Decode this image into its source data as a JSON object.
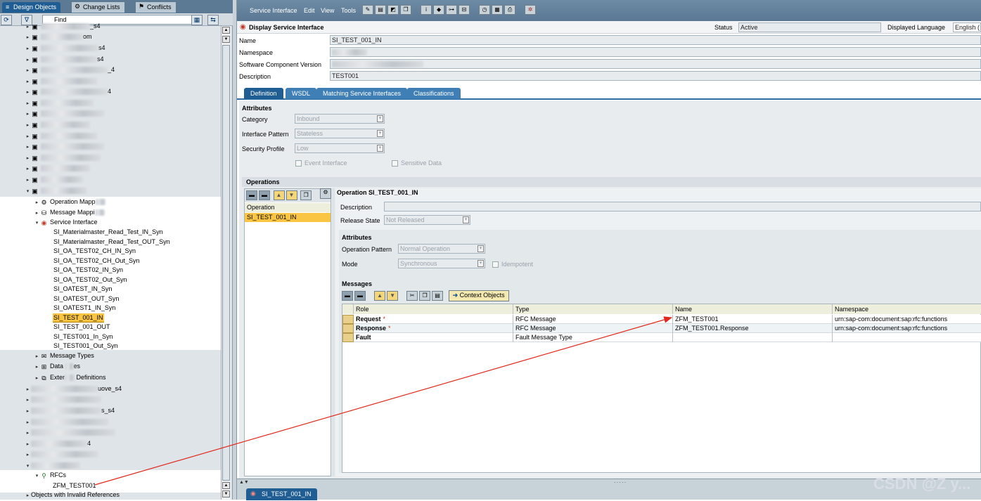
{
  "left_tabs": [
    {
      "label": "Design Objects"
    },
    {
      "label": "Change Lists"
    },
    {
      "label": "Conflicts"
    }
  ],
  "left_toolbar": {
    "find_label": "Find"
  },
  "tree": {
    "visible_fragments": [
      "_s4",
      "om",
      "s4",
      "s4",
      "_4",
      "4",
      "_s4",
      "_s4"
    ],
    "sub_nodes": [
      {
        "label": "Operation Mapp",
        "icon": "operation-mapping-icon"
      },
      {
        "label": "Message Mappi",
        "icon": "message-mapping-icon"
      },
      {
        "label": "Service Interface",
        "icon": "service-interface-icon"
      }
    ],
    "service_interfaces": [
      "SI_Materialmaster_Read_Test_IN_Syn",
      "SI_Materialmaster_Read_Test_OUT_Syn",
      "SI_OA_TEST02_CH_IN_Syn",
      "SI_OA_TEST02_CH_Out_Syn",
      "SI_OA_TEST02_IN_Syn",
      "SI_OA_TEST02_Out_Syn",
      "SI_OATEST_IN_Syn",
      "SI_OATEST_OUT_Syn",
      "SI_OATEST1_IN_Syn",
      "SI_TEST_001_IN",
      "SI_TEST_001_OUT",
      "SI_TEST001_In_Syn",
      "SI_TEST001_Out_Syn"
    ],
    "selected_interface": "SI_TEST_001_IN",
    "after_nodes": [
      {
        "label": "Message Types"
      },
      {
        "label": "Data ",
        "suffix": "es"
      },
      {
        "label": "Exter",
        "suffix": " Definitions"
      }
    ],
    "lower_fragments": [
      "uove_s4",
      "s_s4",
      "4",
      "4"
    ],
    "rfc_label": "RFCs",
    "rfc_item": "ZFM_TEST001",
    "invalid_refs": "Objects with Invalid References"
  },
  "menu": [
    "Service Interface",
    "Edit",
    "View",
    "Tools"
  ],
  "header": {
    "title": "Display Service Interface",
    "status_label": "Status",
    "status_value": "Active",
    "lang_label": "Displayed Language",
    "lang_value": "English ("
  },
  "fields": {
    "name_label": "Name",
    "name_value": "SI_TEST_001_IN",
    "namespace_label": "Namespace",
    "swcv_label": "Software Component Version",
    "desc_label": "Description",
    "desc_value": "TEST001"
  },
  "detail_tabs": [
    "Definition",
    "WSDL",
    "Matching Service Interfaces",
    "Classifications"
  ],
  "attributes": {
    "heading": "Attributes",
    "category_label": "Category",
    "category_value": "Inbound",
    "pattern_label": "Interface Pattern",
    "pattern_value": "Stateless",
    "security_label": "Security Profile",
    "security_value": "Low",
    "event_label": "Event Interface",
    "sensitive_label": "Sensitive Data"
  },
  "operations": {
    "heading": "Operations",
    "column": "Operation",
    "items": [
      "SI_TEST_001_IN"
    ],
    "detail_title": "Operation SI_TEST_001_IN",
    "desc_label": "Description",
    "release_label": "Release State",
    "release_value": "Not Released",
    "attr_heading": "Attributes",
    "op_pattern_label": "Operation Pattern",
    "op_pattern_value": "Normal Operation",
    "mode_label": "Mode",
    "mode_value": "Synchronous",
    "idempotent_label": "Idempotent"
  },
  "messages": {
    "heading": "Messages",
    "context_button": "Context Objects",
    "columns": [
      "Role",
      "Type",
      "Name",
      "Namespace"
    ],
    "rows": [
      {
        "role": "Request",
        "req": "*",
        "type": "RFC Message",
        "name": "ZFM_TEST001",
        "ns": "urn:sap-com:document:sap:rfc:functions"
      },
      {
        "role": "Response",
        "req": "*",
        "type": "RFC Message",
        "name": "ZFM_TEST001.Response",
        "ns": "urn:sap-com:document:sap:rfc:functions"
      },
      {
        "role": "Fault",
        "req": "",
        "type": "Fault Message Type",
        "name": "",
        "ns": ""
      }
    ]
  },
  "bottom_tab": "SI_TEST_001_IN",
  "watermark": "CSDN @Z y...",
  "colors": {
    "accent": "#2d6da3",
    "selection": "#f9c542",
    "arrow": "#e0291c"
  }
}
